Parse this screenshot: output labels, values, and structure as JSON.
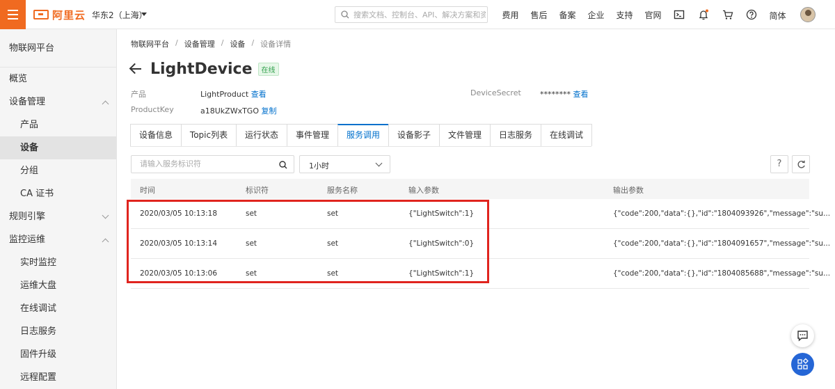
{
  "topbar": {
    "logo_text": "阿里云",
    "region": "华东2（上海）",
    "search_placeholder": "搜索文档、控制台、API、解决方案和资源",
    "links": [
      "费用",
      "售后",
      "备案",
      "企业",
      "支持",
      "官网"
    ],
    "language": "简体"
  },
  "sidebar": {
    "title": "物联网平台",
    "items": [
      {
        "label": "概览",
        "level": 1
      },
      {
        "label": "设备管理",
        "level": 1,
        "expanded": true
      },
      {
        "label": "产品",
        "level": 2
      },
      {
        "label": "设备",
        "level": 2,
        "active": true
      },
      {
        "label": "分组",
        "level": 2
      },
      {
        "label": "CA 证书",
        "level": 2
      },
      {
        "label": "规则引擎",
        "level": 1,
        "expanded": false
      },
      {
        "label": "监控运维",
        "level": 1,
        "expanded": true
      },
      {
        "label": "实时监控",
        "level": 2
      },
      {
        "label": "运维大盘",
        "level": 2
      },
      {
        "label": "在线调试",
        "level": 2
      },
      {
        "label": "日志服务",
        "level": 2
      },
      {
        "label": "固件升级",
        "level": 2
      },
      {
        "label": "远程配置",
        "level": 2
      }
    ]
  },
  "breadcrumb": [
    "物联网平台",
    "设备管理",
    "设备",
    "设备详情"
  ],
  "device": {
    "name": "LightDevice",
    "status": "在线",
    "product_label": "产品",
    "product_value": "LightProduct",
    "product_link": "查看",
    "productkey_label": "ProductKey",
    "productkey_value": "a18UkZWxTGO",
    "productkey_link": "复制",
    "secret_label": "DeviceSecret",
    "secret_value": "********",
    "secret_link": "查看"
  },
  "tabs": [
    "设备信息",
    "Topic列表",
    "运行状态",
    "事件管理",
    "服务调用",
    "设备影子",
    "文件管理",
    "日志服务",
    "在线调试"
  ],
  "active_tab": "服务调用",
  "filter": {
    "search_placeholder": "请输入服务标识符",
    "time_range": "1小时"
  },
  "table": {
    "columns": [
      "时间",
      "标识符",
      "服务名称",
      "输入参数",
      "输出参数"
    ],
    "rows": [
      [
        "2020/03/05 10:13:18",
        "set",
        "set",
        "{\"LightSwitch\":1}",
        "{\"code\":200,\"data\":{},\"id\":\"1804093926\",\"message\":\"su..."
      ],
      [
        "2020/03/05 10:13:14",
        "set",
        "set",
        "{\"LightSwitch\":0}",
        "{\"code\":200,\"data\":{},\"id\":\"1804091657\",\"message\":\"su..."
      ],
      [
        "2020/03/05 10:13:06",
        "set",
        "set",
        "{\"LightSwitch\":1}",
        "{\"code\":200,\"data\":{},\"id\":\"1804085688\",\"message\":\"su..."
      ]
    ]
  },
  "colors": {
    "brand": "#f06a20",
    "link": "#0070cc",
    "highlight": "#e0241e",
    "online": "#2e9e4a"
  }
}
